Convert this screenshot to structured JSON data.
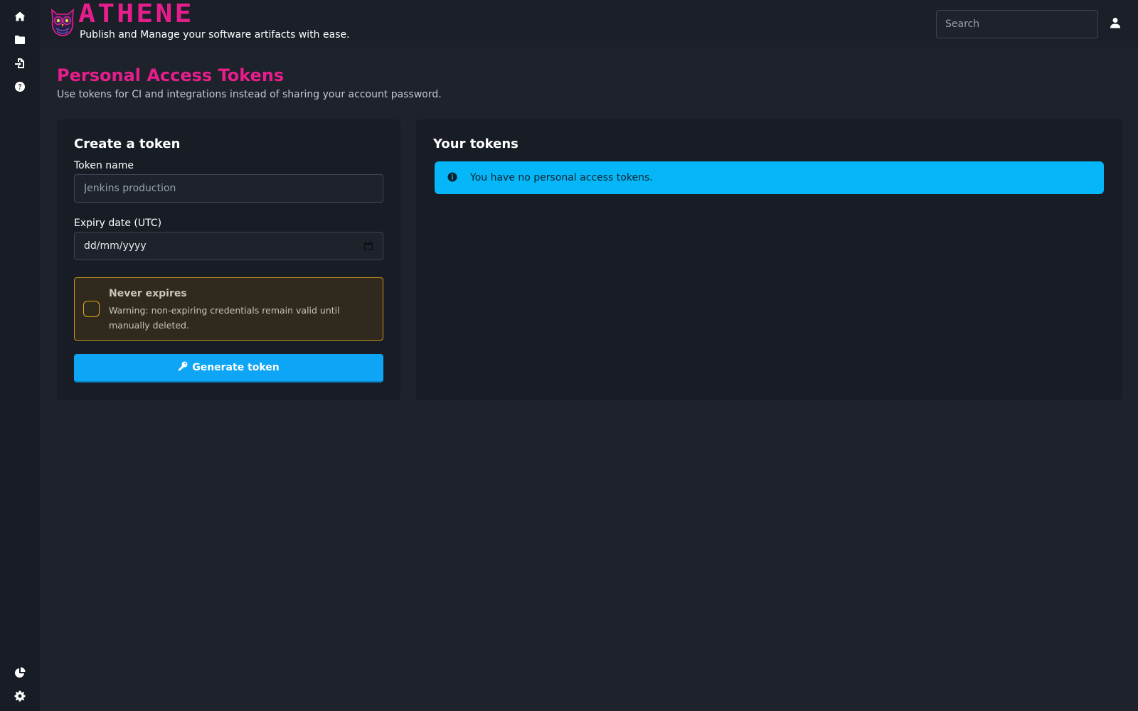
{
  "app": {
    "brand": "ATHENE",
    "tagline": "Publish and Manage your software artifacts with ease."
  },
  "sidebar": {
    "top_items": [
      {
        "icon": "home-icon"
      },
      {
        "icon": "folder-icon"
      },
      {
        "icon": "file-import-icon"
      },
      {
        "icon": "question-circle-icon"
      }
    ],
    "bottom_items": [
      {
        "icon": "chart-pie-icon"
      },
      {
        "icon": "gear-icon"
      }
    ]
  },
  "header": {
    "search_placeholder": "Search",
    "user_icon": "user-icon"
  },
  "page": {
    "title": "Personal Access Tokens",
    "subtitle": "Use tokens for CI and integrations instead of sharing your account password."
  },
  "create_card": {
    "title": "Create a token",
    "token_name_label": "Token name",
    "token_name_placeholder": "Jenkins production",
    "expiry_label": "Expiry date (UTC)",
    "expiry_value": "dd/mm/yyyy",
    "never_expires_label": "Never expires",
    "never_expires_warning": "Warning: non-expiring credentials remain valid until manually deleted.",
    "never_expires_checked": false,
    "generate_label": "Generate token"
  },
  "tokens_card": {
    "title": "Your tokens",
    "empty_message": "You have no personal access tokens."
  },
  "colors": {
    "brand_pink": "#e61e8c",
    "primary_blue": "#0ea5f6",
    "info_cyan": "#05b7f8",
    "warning_amber": "#e0a81d",
    "background": "#1d222b"
  }
}
